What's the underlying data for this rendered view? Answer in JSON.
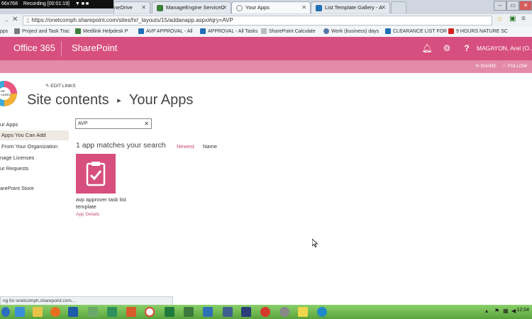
{
  "browser": {
    "recording_label": "Recording [00:01:19]",
    "resolution_label": "66x768",
    "tabs": [
      {
        "label": "neDrive",
        "icon": "onedrive-icon"
      },
      {
        "label": "ManageEngine ServiceD",
        "icon": "manageengine-icon"
      },
      {
        "label": "Your Apps",
        "icon": "loading-icon"
      },
      {
        "label": "List Template Gallery - A",
        "icon": "sharepoint-icon"
      }
    ],
    "url": "https://onetcomph.sharepoint.com/sites/hr/_layouts/15/addanapp.aspx#qry=AVP",
    "bookmarks": [
      "pps",
      "Project and Task Trac",
      "Medilink Helpdesk P",
      "AVP APPROVAL - All",
      "APPROVAL - All Tasks",
      "SharePoint Calculate",
      "Work (business) days",
      "CLEARANCE LIST FOR",
      "9 HOURS NATURE SC"
    ],
    "status_text": "ng for onetcomph.sharepoint.com..."
  },
  "suite": {
    "brand": "Office 365",
    "app": "SharePoint",
    "user": "MAGAYON, Arel (O..."
  },
  "subbar": {
    "share": "SHARE",
    "follow": "FOLLOW"
  },
  "page": {
    "edit_links": "EDIT LINKS",
    "title_part1": "Site contents",
    "title_arrow": "▸",
    "title_part2": "Your Apps",
    "logo_text": "HR CARES",
    "search_value": "AVP",
    "match_text": "1 app matches your search",
    "sort_newest": "Newest",
    "sort_name": "Name"
  },
  "nav": [
    {
      "label": "ur Apps",
      "selected": false
    },
    {
      "label": "Apps You Can Add",
      "selected": true
    },
    {
      "label": "From Your Organization",
      "selected": false
    },
    {
      "label": "nage Licenses",
      "selected": false
    },
    {
      "label": "ur Requests",
      "selected": false
    },
    {
      "label": "arePoint Store",
      "selected": false
    }
  ],
  "app": {
    "name": "avp approver task list template",
    "details": "App Details"
  },
  "taskbar": {
    "clock": "12:04"
  },
  "colors": {
    "suite_bar": "#d74f7e",
    "sub_bar": "#e38aa9",
    "accent_link": "#c94b78"
  }
}
